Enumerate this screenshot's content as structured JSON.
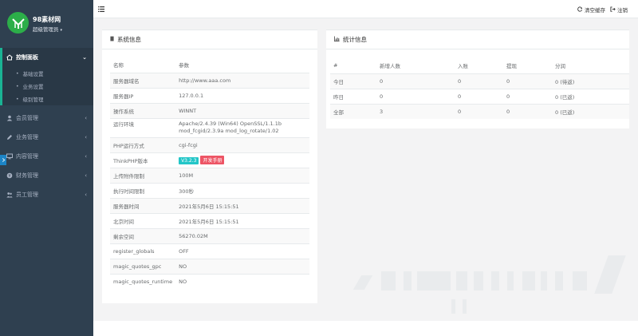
{
  "sidebar": {
    "brand": "98素材网",
    "role": "超级管理员",
    "caret": "▾",
    "active_menu": {
      "label": "控制面板",
      "arrow": "⌄"
    },
    "submenu": [
      {
        "label": "基础设置"
      },
      {
        "label": "业务设置"
      },
      {
        "label": "级别管理"
      }
    ],
    "menus": [
      {
        "label": "会员管理",
        "icon": "user-icon",
        "arrow": "‹"
      },
      {
        "label": "业务管理",
        "icon": "edit-icon",
        "arrow": "‹"
      },
      {
        "label": "内容管理",
        "icon": "pc-icon",
        "arrow": "‹"
      },
      {
        "label": "财务管理",
        "icon": "coin-icon",
        "arrow": "‹"
      },
      {
        "label": "员工管理",
        "icon": "team-icon",
        "arrow": "‹"
      }
    ]
  },
  "topbar": {
    "clear_cache": "清空缓存",
    "logout": "注销"
  },
  "system_panel": {
    "title": "系统信息",
    "header": {
      "name": "名称",
      "param": "参数"
    },
    "rows": [
      {
        "key": "服务器域名",
        "value": "http://www.aaa.com"
      },
      {
        "key": "服务器IP",
        "value": "127.0.0.1"
      },
      {
        "key": "操作系统",
        "value": "WINNT"
      },
      {
        "key": "运行环境",
        "value": "Apache/2.4.39 (Win64) OpenSSL/1.1.1b",
        "value2": "mod_fcgid/2.3.9a mod_log_rotate/1.02"
      },
      {
        "key": "PHP运行方式",
        "value": "cgi-fcgi"
      },
      {
        "key": "ThinkPHP版本",
        "badge1": "V3.2.3",
        "badge2": "开发手册"
      },
      {
        "key": "上传附件限制",
        "value": "100M"
      },
      {
        "key": "执行时间限制",
        "value": "300秒"
      },
      {
        "key": "服务器时间",
        "value": "2021年5月6日 15:15:51"
      },
      {
        "key": "北京时间",
        "value": "2021年5月6日 15:15:51"
      },
      {
        "key": "剩余空间",
        "value": "56270.02M"
      },
      {
        "key": "register_globals",
        "value": "OFF"
      },
      {
        "key": "magic_quotes_gpc",
        "value": "NO"
      },
      {
        "key": "magic_quotes_runtime",
        "value": "NO"
      }
    ]
  },
  "stats_panel": {
    "title": "统计信息",
    "headers": [
      "#",
      "新增人数",
      "入账",
      "提现",
      "分润"
    ],
    "rows": [
      [
        "今日",
        "0",
        "0",
        "0",
        "0 (待返)"
      ],
      [
        "昨日",
        "0",
        "0",
        "0",
        "0 (已返)"
      ],
      [
        "全部",
        "3",
        "0",
        "0",
        "0 (已返)"
      ]
    ]
  },
  "colors": {
    "sidebar_bg": "#2f4050",
    "accent": "#1ab394",
    "badge_blue": "#23c6c8",
    "badge_red": "#ed5565"
  }
}
